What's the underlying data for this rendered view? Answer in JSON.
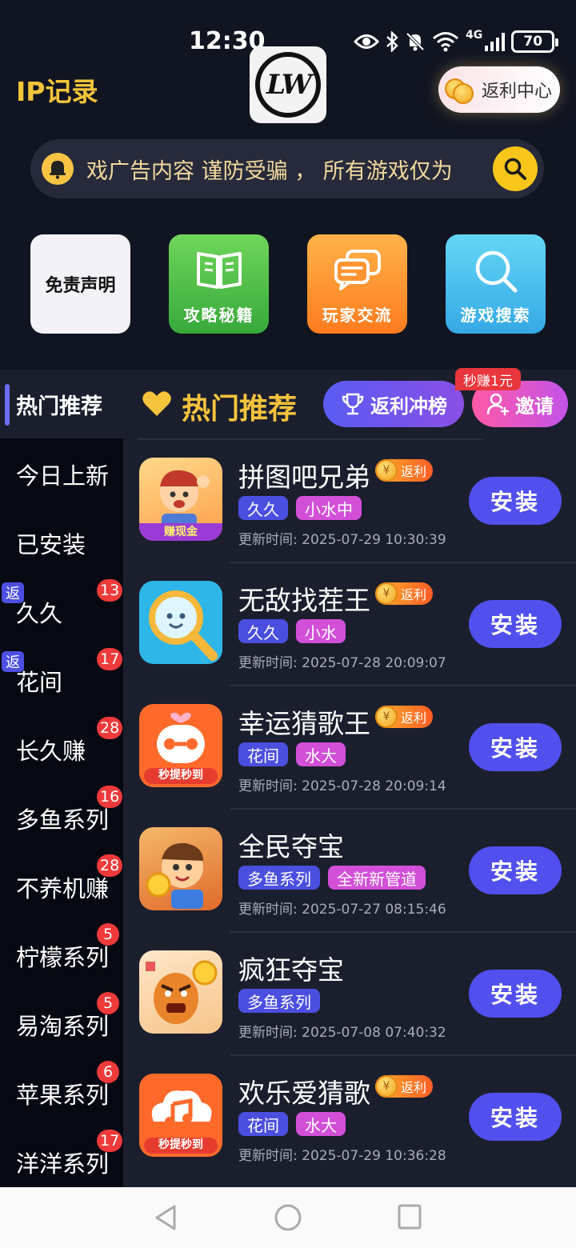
{
  "status_bar": {
    "time": "12:30",
    "battery": "70",
    "network": "4G"
  },
  "header": {
    "brand": "IP记录",
    "rebate_center": "返利中心"
  },
  "notice": {
    "text": "戏广告内容 谨防受骗 ， 所有游戏仅为"
  },
  "quick_tiles": [
    {
      "label": "免责声明",
      "icon": "document"
    },
    {
      "label": "攻略秘籍",
      "icon": "book-icon"
    },
    {
      "label": "玩家交流",
      "icon": "chat-bubbles-icon"
    },
    {
      "label": "游戏搜索",
      "icon": "search-icon"
    }
  ],
  "section": {
    "sidebar_active": "热门推荐",
    "title": "热门推荐",
    "rank_button": "返利冲榜",
    "invite_button": "邀请",
    "invite_tag": "秒赚1元"
  },
  "sidebar": {
    "rebate_mark": "返",
    "items": [
      {
        "label": "今日上新",
        "count": "",
        "fan": false
      },
      {
        "label": "已安装",
        "count": "",
        "fan": false
      },
      {
        "label": "久久",
        "count": "13",
        "fan": true
      },
      {
        "label": "花间",
        "count": "17",
        "fan": true
      },
      {
        "label": "长久赚",
        "count": "28",
        "fan": false
      },
      {
        "label": "多鱼系列",
        "count": "16",
        "fan": false
      },
      {
        "label": "不养机赚",
        "count": "28",
        "fan": false
      },
      {
        "label": "柠檬系列",
        "count": "5",
        "fan": false
      },
      {
        "label": "易淘系列",
        "count": "5",
        "fan": false
      },
      {
        "label": "苹果系列",
        "count": "6",
        "fan": false
      },
      {
        "label": "洋洋系列",
        "count": "17",
        "fan": false
      }
    ]
  },
  "apps": {
    "fanli_label": "返利",
    "fanli_coin": "¥",
    "install_label": "安装",
    "items": [
      {
        "name": "拼图吧兄弟",
        "fanli": true,
        "tags": [
          "久久",
          "小水中"
        ],
        "updated": "更新时间: 2025-07-29 10:30:39",
        "icon_caption": "赚现金"
      },
      {
        "name": "无敌找茬王",
        "fanli": true,
        "tags": [
          "久久",
          "小水"
        ],
        "updated": "更新时间: 2025-07-28 20:09:07",
        "icon_caption": ""
      },
      {
        "name": "幸运猜歌王",
        "fanli": true,
        "tags": [
          "花间",
          "水大"
        ],
        "updated": "更新时间: 2025-07-28 20:09:14",
        "icon_caption": "秒提秒到"
      },
      {
        "name": "全民夺宝",
        "fanli": false,
        "tags": [
          "多鱼系列",
          "全新新管道"
        ],
        "updated": "更新时间: 2025-07-27 08:15:46",
        "icon_caption": ""
      },
      {
        "name": "疯狂夺宝",
        "fanli": false,
        "tags": [
          "多鱼系列"
        ],
        "updated": "更新时间: 2025-07-08 07:40:32",
        "icon_caption": ""
      },
      {
        "name": "欢乐爱猜歌",
        "fanli": true,
        "tags": [
          "花间",
          "水大"
        ],
        "updated": "更新时间: 2025-07-29 10:36:28",
        "icon_caption": "秒提秒到"
      }
    ]
  },
  "colors": {
    "accent": "#5150ee",
    "gold": "#f6c33c",
    "background": "#111521"
  }
}
